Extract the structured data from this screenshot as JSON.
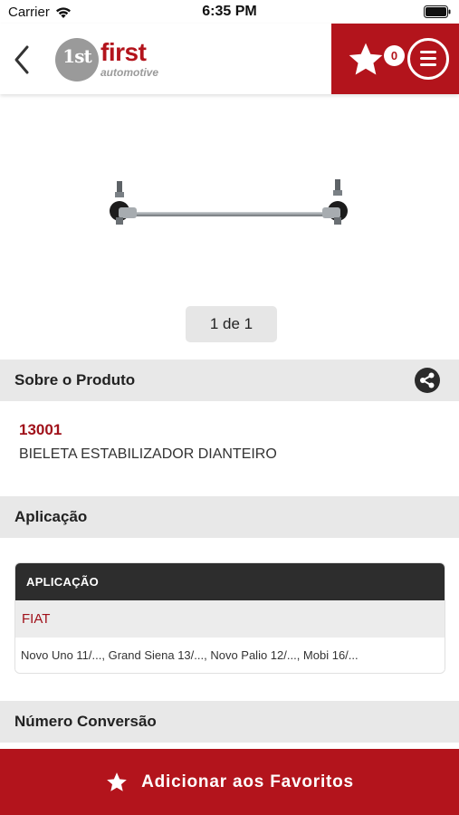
{
  "status_bar": {
    "carrier": "Carrier",
    "time": "6:35 PM"
  },
  "header": {
    "logo_badge": "1st",
    "logo_word": "first",
    "logo_sub": "automotive",
    "favorites_count": "0"
  },
  "gallery": {
    "pager": "1 de 1"
  },
  "about": {
    "title": "Sobre o Produto",
    "code": "13001",
    "description": "BIELETA ESTABILIZADOR DIANTEIRO"
  },
  "application": {
    "title": "Aplicação",
    "table_header": "APLICAÇÃO",
    "brand": "FIAT",
    "models": "Novo Uno 11/..., Grand Siena 13/..., Novo Palio 12/..., Mobi 16/..."
  },
  "conversion": {
    "title": "Número Conversão"
  },
  "footer": {
    "add_favorites_label": "Adicionar aos Favoritos"
  },
  "colors": {
    "brand_red": "#b3141c",
    "dark_header": "#2d2d2d",
    "section_gray": "#e8e8e8"
  },
  "icons": [
    "wifi-icon",
    "battery-icon",
    "back-chevron-icon",
    "star-icon",
    "menu-icon",
    "share-icon"
  ]
}
